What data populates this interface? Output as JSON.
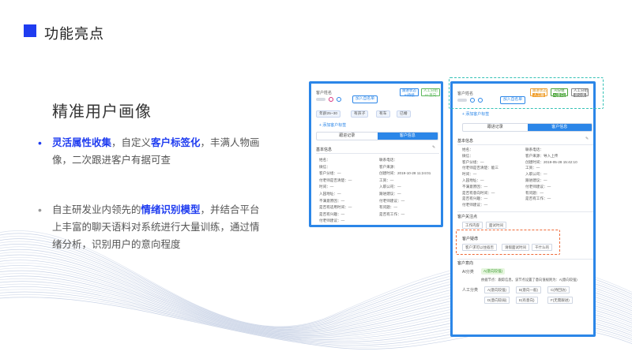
{
  "header": {
    "title": "功能亮点"
  },
  "section": {
    "title": "精准用户画像"
  },
  "bullets": [
    {
      "parts": [
        {
          "t": "灵活属性收集",
          "hl": true
        },
        {
          "t": "，自定义",
          "hl": false
        },
        {
          "t": "客户标签化",
          "hl": true
        },
        {
          "t": "，丰满人物画像，二次跟进客户有据可查",
          "hl": false
        }
      ]
    },
    {
      "parts": [
        {
          "t": "自主研发业内领先的",
          "hl": false
        },
        {
          "t": "情绪识别模型",
          "hl": true
        },
        {
          "t": "，并结合平台上丰富的聊天语料对系统进行大量训练，通过情绪分析，识别用户的意向程度",
          "hl": false
        }
      ]
    }
  ],
  "bullet_marker": "•",
  "card1": {
    "name_label": "客户姓名",
    "add_contact": "加入自名单",
    "status_tags": [
      {
        "top": "跟进状态",
        "bottom": "AI待绩"
      },
      {
        "top": "人工分组",
        "bottom": "AI 意向"
      }
    ],
    "tags": [
      "年龄25~30",
      "有孩子",
      "有车",
      "已婚"
    ],
    "add_tag": "+ 添加客户标签",
    "tabs": [
      "跟进记录",
      "客户信息"
    ],
    "section": "基本信息",
    "left_fields": [
      "姓名：",
      "微信：",
      "客户分组：—",
      "付老师是否清楚：—",
      "时间：—",
      "入园地址：—",
      "不满意原因：—",
      "是否有适用时间：—",
      "是否有兴趣：—",
      "付老师建议：—"
    ],
    "right_fields": [
      "联系电话：",
      "客户来源：",
      "创建时间：2019-10-28 11:24:01",
      "工资：—",
      "入职公司：—",
      "跟进建议：—",
      "付老师建议：—",
      "有问题：—",
      "是否有工作：—"
    ]
  },
  "card2": {
    "name_label": "客户姓名",
    "add_contact": "加入自名单",
    "status_tags": [
      {
        "top": "跟进状态",
        "bottom": "人工跟"
      },
      {
        "top": "AI分组",
        "bottom": "A(意向)"
      },
      {
        "top": "人工分组",
        "bottom": "待分类"
      }
    ],
    "add_tag": "+ 添加客户标签",
    "tabs": [
      "跟进记录",
      "客户信息"
    ],
    "section": "基本信息",
    "left_fields": [
      "姓名：",
      "微信：",
      "客户分组：—",
      "付老师是否清楚：能三",
      "时间：—",
      "入园地址：—",
      "不满意原因：—",
      "是否有意向时间：—",
      "是否有兴趣：—",
      "付老师建议：—"
    ],
    "right_fields": [
      "联系电话：",
      "客户来源：导入上传",
      "创建时间：2019-05-28 15:42:10",
      "工资：—",
      "入职公司：—",
      "跟进建议：—",
      "付老师建议：—",
      "有问题：—",
      "是否有工作：—"
    ],
    "question_section": "客户关注点",
    "question_tags": [
      "工作内容",
      "面试时间"
    ],
    "concern_section": "客户疑虑",
    "concern_tags": [
      "客户求可以住宿否",
      "请假面试时间",
      "干什么的"
    ],
    "intent_section": "客户意向",
    "ai_label": "AI分类",
    "ai_value": "A(意向较强)",
    "ai_note": "依据节点：跟踪信息，该节点设置了意向值规则为：A(意向较强)",
    "manual_label": "人工分类",
    "manual_tags": [
      "A(意向较强)",
      "B(意向一般)",
      "C(待回访)",
      "D(意向较弱)",
      "E(有意向)",
      "F(无需跟进)"
    ]
  }
}
